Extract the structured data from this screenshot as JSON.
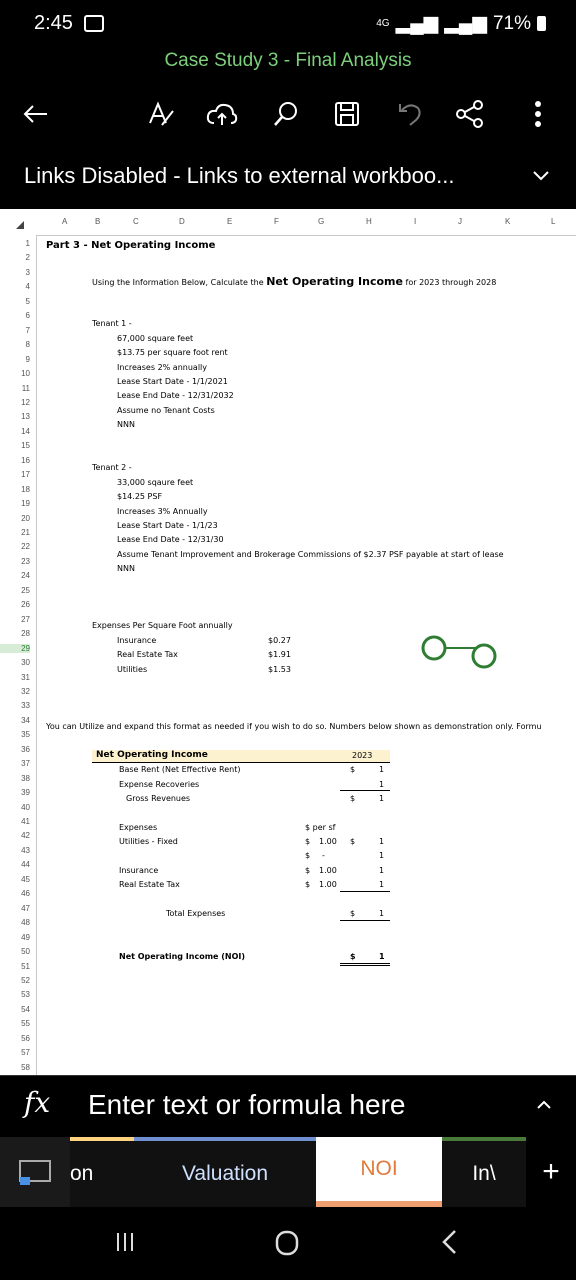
{
  "status": {
    "time": "2:45",
    "network": "4G",
    "battery": "71%"
  },
  "doc_title": "Case Study 3 - Final Analysis",
  "banner": {
    "text": "Links Disabled - Links to external workboo..."
  },
  "columns": [
    "A",
    "B",
    "C",
    "D",
    "E",
    "F",
    "G",
    "H",
    "I",
    "J",
    "K",
    "L"
  ],
  "rows": [
    "1",
    "2",
    "3",
    "4",
    "5",
    "6",
    "7",
    "8",
    "9",
    "10",
    "11",
    "12",
    "13",
    "14",
    "15",
    "16",
    "17",
    "18",
    "19",
    "20",
    "21",
    "22",
    "23",
    "24",
    "25",
    "26",
    "27",
    "28",
    "29",
    "30",
    "31",
    "32",
    "33",
    "34",
    "35",
    "36",
    "37",
    "38",
    "39",
    "40",
    "41",
    "42",
    "43",
    "44",
    "45",
    "46",
    "47",
    "48",
    "49",
    "50",
    "51",
    "52",
    "53",
    "54",
    "55",
    "56",
    "57",
    "58"
  ],
  "sheet": {
    "part_title": "Part 3 - Net Operating Income",
    "instr_pre": "Using the Information Below, Calculate the",
    "instr_bold": "Net Operating Income",
    "instr_post": "for 2023 through 2028",
    "tenant1": [
      "Tenant 1 -",
      "67,000 square feet",
      "$13.75 per square foot rent",
      "Increases 2% annually",
      "Lease Start Date -  1/1/2021",
      "Lease End Date -  12/31/2032",
      "Assume no Tenant Costs",
      "NNN"
    ],
    "tenant2": [
      "Tenant 2 -",
      "33,000 sqaure feet",
      "$14.25 PSF",
      "Increases 3% Annually",
      "Lease Start Date - 1/1/23",
      "Lease End Date - 12/31/30",
      "Assume Tenant Improvement and Brokerage Commissions of $2.37 PSF payable at start of lease",
      "NNN"
    ],
    "expenses_title": "Expenses Per Square Foot annually",
    "expenses": [
      {
        "label": "Insurance",
        "value": "$0.27"
      },
      {
        "label": "Real Estate Tax",
        "value": "$1.91"
      },
      {
        "label": "Utilities",
        "value": "$1.53"
      }
    ],
    "note": "You can Utilize and expand this format as needed if you wish to do so.  Numbers below shown as demonstration only.  Formu",
    "noi_header": "Net Operating Income",
    "year": "2023",
    "base_rent": "Base Rent (Net Effective Rent)",
    "expense_recoveries": "Expense Recoveries",
    "gross_revenues": "Gross Revenues",
    "expenses_label": "Expenses",
    "per_sf": "$ per sf",
    "utilities_fixed": "Utilities - Fixed",
    "insurance": "Insurance",
    "real_estate_tax": "Real Estate Tax",
    "total_expenses": "Total Expenses",
    "noi_label": "Net Operating Income (NOI)",
    "dollar": "$",
    "one": "1",
    "dash": "-",
    "psf_100": "1.00"
  },
  "formula_bar": {
    "placeholder": "Enter text or formula here"
  },
  "tabs": [
    {
      "label": "on",
      "color": "#ffd27f"
    },
    {
      "label": "Valuation",
      "color": "#6f8fd0"
    },
    {
      "label": "NOI",
      "color": "#f0a070"
    },
    {
      "label": "In\\",
      "color": "#4a7a3a"
    }
  ],
  "colors": {
    "accent": "#7ccf7c",
    "sheet_bg": "#ffffff",
    "toolbar_bg": "#000000"
  }
}
